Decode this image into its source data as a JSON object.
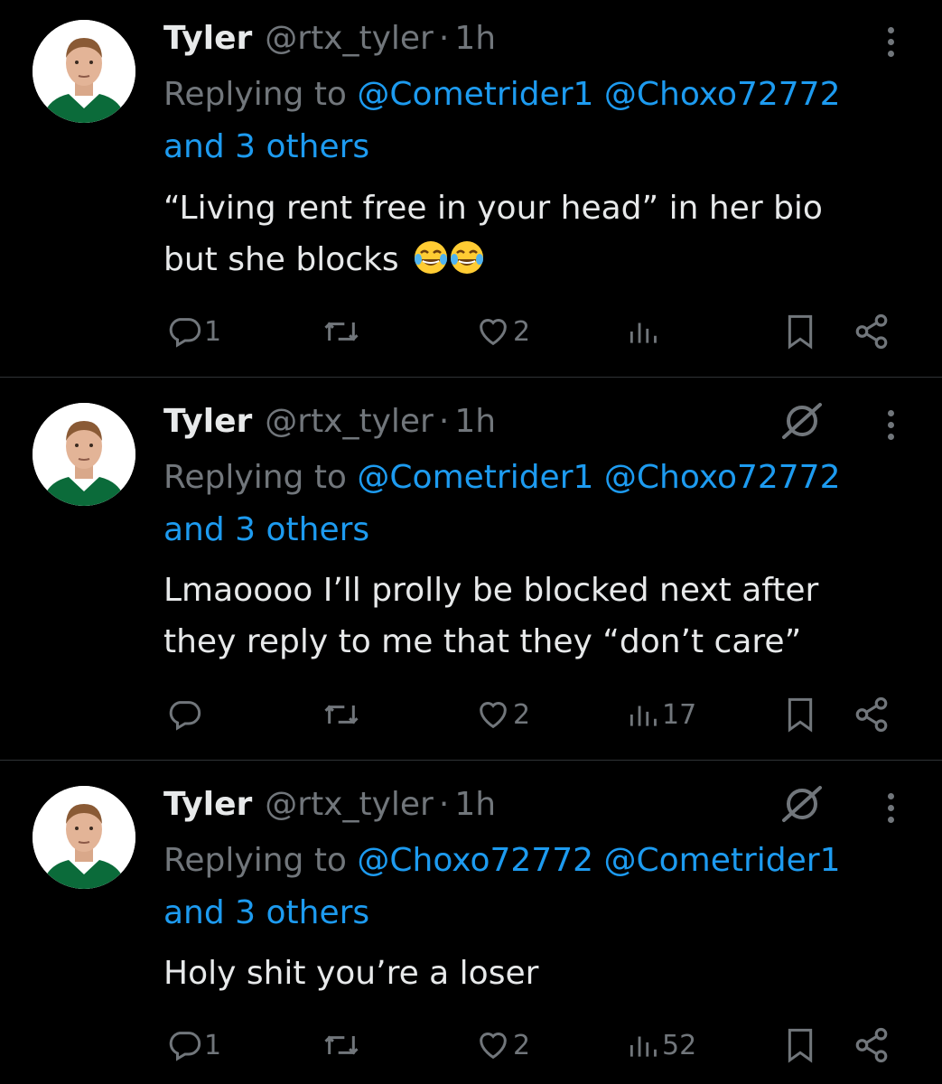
{
  "tweets": [
    {
      "name": "Tyler",
      "handle": "@rtx_tyler",
      "separator": "·",
      "time": "1h",
      "replying_prefix": "Replying to ",
      "mention1": "@Cometrider1",
      "mention2": "@Choxo72772",
      "others": "and 3 others",
      "line1": "“Living rent free in your head” in her bio",
      "line2": "but she blocks",
      "emojis": [
        "tears-of-joy-emoji",
        "tears-of-joy-emoji"
      ],
      "show_grok": false,
      "replies": "1",
      "likes": "2",
      "views": ""
    },
    {
      "name": "Tyler",
      "handle": "@rtx_tyler",
      "separator": "·",
      "time": "1h",
      "replying_prefix": "Replying to ",
      "mention1": "@Cometrider1",
      "mention2": "@Choxo72772",
      "others": "and 3 others",
      "line1": "Lmaoooo I’ll prolly be blocked next after",
      "line2": "they reply to me that they “don’t care”",
      "show_grok": true,
      "replies": "",
      "likes": "2",
      "views": "17"
    },
    {
      "name": "Tyler",
      "handle": "@rtx_tyler",
      "separator": "·",
      "time": "1h",
      "replying_prefix": "Replying to ",
      "mention1": "@Choxo72772",
      "mention2": "@Cometrider1",
      "others": "and 3 others",
      "line1": "Holy shit you’re a loser",
      "line2": "",
      "show_grok": true,
      "replies": "1",
      "likes": "2",
      "views": "52"
    }
  ],
  "icons": {
    "reply": "reply-icon",
    "retweet": "retweet-icon",
    "like": "heart-icon",
    "views": "views-icon",
    "bookmark": "bookmark-icon",
    "share": "share-icon",
    "more": "more-icon",
    "grok": "grok-icon"
  },
  "colors": {
    "background": "#000000",
    "text": "#e7e9ea",
    "muted": "#71767b",
    "link": "#1d9bf0",
    "divider": "#2f3336"
  }
}
